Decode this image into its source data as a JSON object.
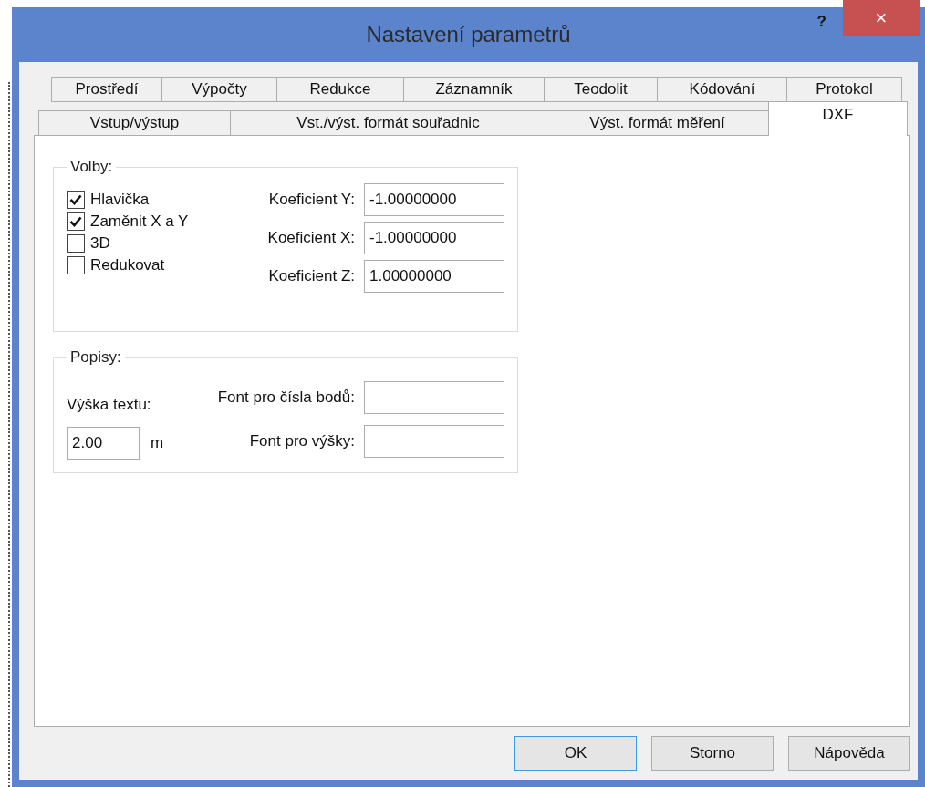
{
  "window": {
    "title": "Nastavení parametrů",
    "help_button": "?",
    "close_button": "×"
  },
  "tab_rows": [
    {
      "tabs": [
        {
          "label": "Prostředí",
          "selected": false
        },
        {
          "label": "Výpočty",
          "selected": false
        },
        {
          "label": "Redukce",
          "selected": false
        },
        {
          "label": "Záznamník",
          "selected": false
        },
        {
          "label": "Teodolit",
          "selected": false
        },
        {
          "label": "Kódování",
          "selected": false
        },
        {
          "label": "Protokol",
          "selected": false
        }
      ]
    },
    {
      "tabs": [
        {
          "label": "Vstup/výstup",
          "selected": false
        },
        {
          "label": "Vst./výst. formát souřadnic",
          "selected": false
        },
        {
          "label": "Výst. formát měření",
          "selected": false
        },
        {
          "label": "DXF",
          "selected": true
        }
      ]
    }
  ],
  "options": {
    "title": "Volby:",
    "checkboxes": [
      {
        "label": "Hlavička",
        "checked": true
      },
      {
        "label": "Zaměnit X a Y",
        "checked": true
      },
      {
        "label": "3D",
        "checked": false
      },
      {
        "label": "Redukovat",
        "checked": false
      }
    ],
    "fields": [
      {
        "label": "Koeficient Y:",
        "value": "-1.00000000"
      },
      {
        "label": "Koeficient X:",
        "value": "-1.00000000"
      },
      {
        "label": "Koeficient Z:",
        "value": "1.00000000"
      }
    ]
  },
  "labels": {
    "title": "Popisy:",
    "text_height": {
      "label": "Výška textu:",
      "value": "2.00",
      "unit": "m"
    },
    "fields": [
      {
        "label": "Font pro čísla bodů:"
      },
      {
        "label": "Font pro výšky:"
      }
    ]
  },
  "buttons": [
    {
      "label": "OK",
      "default": true
    },
    {
      "label": "Storno",
      "default": false
    },
    {
      "label": "Nápověda",
      "default": false
    }
  ]
}
